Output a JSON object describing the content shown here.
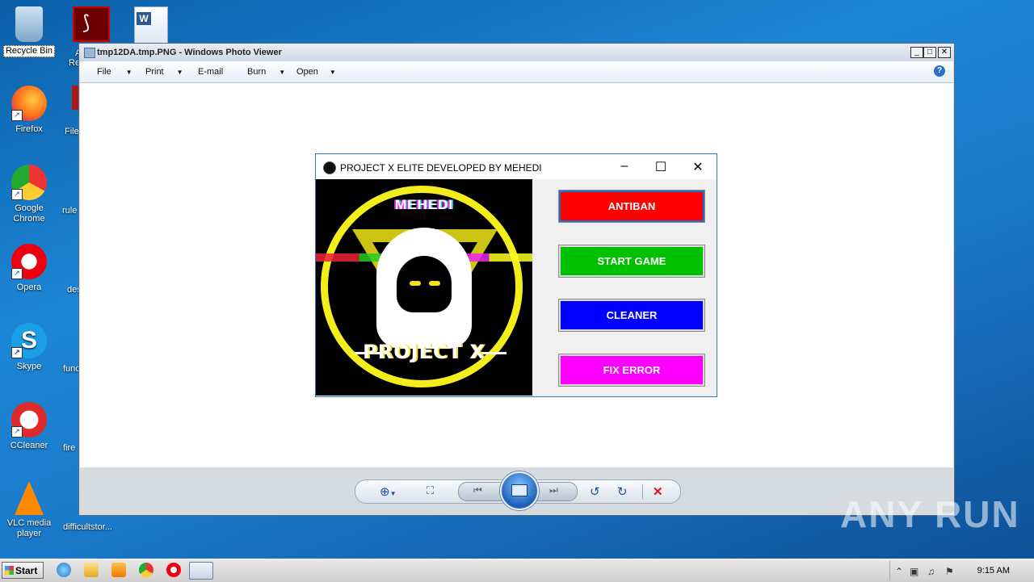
{
  "desktop": {
    "icons": [
      {
        "label": "Recycle Bin"
      },
      {
        "label": "Firefox"
      },
      {
        "label": "Google Chrome"
      },
      {
        "label": "Opera"
      },
      {
        "label": "Skype"
      },
      {
        "label": "CCleaner"
      },
      {
        "label": "VLC media player"
      }
    ],
    "second_column": [
      "A",
      "Re",
      "File",
      "rule",
      "des",
      "func",
      "fire",
      "difficultstor..."
    ]
  },
  "photo_viewer": {
    "title": "tmp12DA.tmp.PNG - Windows Photo Viewer",
    "menu": [
      "File",
      "Print",
      "E-mail",
      "Burn",
      "Open"
    ],
    "help": "?"
  },
  "app": {
    "title": "PROJECT X ELITE DEVELOPED BY MEHEDI",
    "logo_top_text": "MEHEDI",
    "logo_bottom_text": "PROJECT X",
    "buttons": [
      {
        "label": "ANTIBAN",
        "color": "#ff0000"
      },
      {
        "label": "START GAME",
        "color": "#00c000"
      },
      {
        "label": "CLEANER",
        "color": "#0000ff"
      },
      {
        "label": "FIX ERROR",
        "color": "#ff00ff"
      }
    ]
  },
  "taskbar": {
    "start_label": "Start",
    "clock": "9:15 AM"
  },
  "watermark": "ANY RUN"
}
